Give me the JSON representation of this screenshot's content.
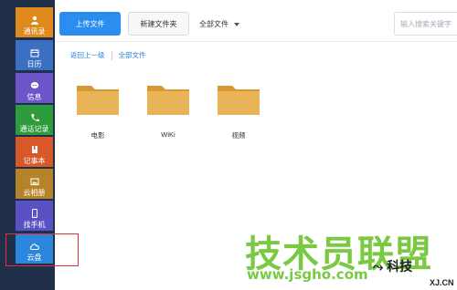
{
  "sidebar": {
    "items": [
      {
        "label": "通讯录",
        "icon": "contacts-icon",
        "color": "#e08a1e"
      },
      {
        "label": "日历",
        "icon": "calendar-icon",
        "color": "#3a6fc4"
      },
      {
        "label": "信息",
        "icon": "message-icon",
        "color": "#6b55c8"
      },
      {
        "label": "通话记录",
        "icon": "phone-icon",
        "color": "#2e9b3c"
      },
      {
        "label": "记事本",
        "icon": "notepad-icon",
        "color": "#d9582a"
      },
      {
        "label": "云相册",
        "icon": "photo-icon",
        "color": "#b7832a"
      },
      {
        "label": "找手机",
        "icon": "find-phone-icon",
        "color": "#5a52c4"
      },
      {
        "label": "云盘",
        "icon": "cloud-icon",
        "color": "#2b86dd"
      }
    ]
  },
  "toolbar": {
    "upload_label": "上传文件",
    "new_folder_label": "新建文件夹",
    "filter_label": "全部文件",
    "search_placeholder": "输入搜索关键字"
  },
  "breadcrumb": {
    "back_label": "返回上一级",
    "all_label": "全部文件"
  },
  "folders": [
    {
      "name": "电影"
    },
    {
      "name": "WiKi"
    },
    {
      "name": "视频"
    }
  ],
  "watermark": {
    "text": "技术员联盟",
    "url": "www.jsgho.com",
    "badge": "⤳ 科技",
    "badge2": "XJ.CN"
  },
  "colors": {
    "accent": "#2c8df1",
    "folder": "#e9b457",
    "highlight": "#e0313a"
  }
}
